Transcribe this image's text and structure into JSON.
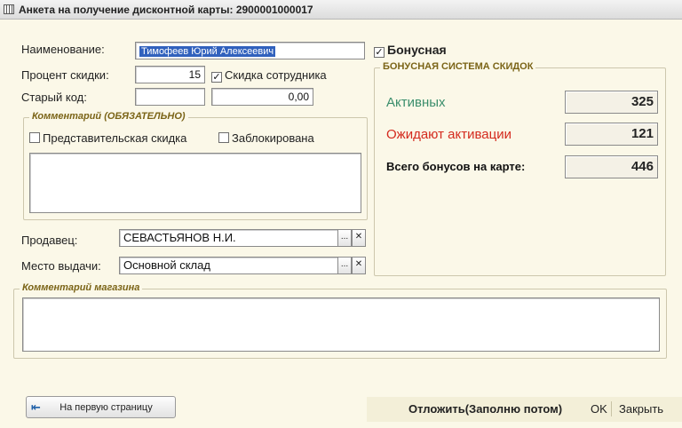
{
  "window": {
    "title": "Анкета на получение дисконтной карты: 2900001000017"
  },
  "form": {
    "name_label": "Наименование:",
    "name_value": "Тимофеев Юрий Алексеевич",
    "discount_label": "Процент скидки:",
    "discount_value": "15",
    "employee_discount_label": "Скидка сотрудника",
    "employee_discount_checked": true,
    "old_code_label": "Старый код:",
    "old_code_value": "",
    "amount_value": "0,00",
    "bonus_label": "Бонусная",
    "bonus_checked": true
  },
  "comment_group": {
    "title": "Комментарий (ОБЯЗАТЕЛЬНО)",
    "representative_label": "Представительская скидка",
    "representative_checked": false,
    "blocked_label": "Заблокирована",
    "blocked_checked": false,
    "text": ""
  },
  "seller": {
    "label": "Продавец:",
    "value": "СЕВАСТЬЯНОВ  Н.И."
  },
  "issue_place": {
    "label": "Место выдачи:",
    "value": "Основной склад"
  },
  "selector": {
    "select_glyph": "...",
    "clear_glyph": "✕"
  },
  "bonus_system": {
    "title": "БОНУСНАЯ СИСТЕМА СКИДОК",
    "active_label": "Активных",
    "active_value": "325",
    "pending_label": "Ожидают активации",
    "pending_value": "121",
    "total_label": "Всего бонусов на карте:",
    "total_value": "446",
    "colors": {
      "active": "#3b8e6c",
      "pending": "#d42a1e",
      "total": "#111111"
    }
  },
  "shop_comment": {
    "title": "Комментарий магазина",
    "text": ""
  },
  "footer": {
    "first_page_label": "На первую страницу",
    "postpone_label": "Отложить(Заполню потом)",
    "ok_label": "OK",
    "close_label": "Закрыть"
  }
}
